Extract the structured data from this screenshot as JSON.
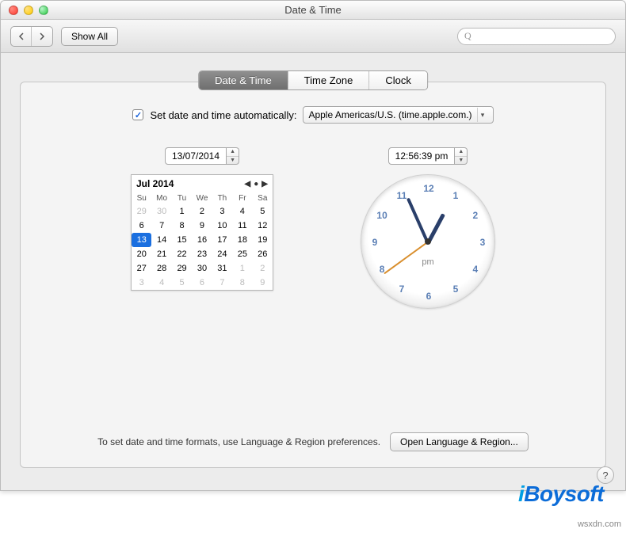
{
  "window": {
    "title": "Date & Time"
  },
  "toolbar": {
    "show_all": "Show All",
    "search_placeholder": ""
  },
  "search_icon_glyph": "Q",
  "tabs": {
    "date_time": "Date & Time",
    "time_zone": "Time Zone",
    "clock": "Clock"
  },
  "auto": {
    "checked": true,
    "label": "Set date and time automatically:",
    "server": "Apple Americas/U.S. (time.apple.com.)"
  },
  "date_field": "13/07/2014",
  "time_field": "12:56:39 pm",
  "calendar": {
    "month_label": "Jul 2014",
    "dow": [
      "Su",
      "Mo",
      "Tu",
      "We",
      "Th",
      "Fr",
      "Sa"
    ],
    "cells": [
      {
        "d": "29",
        "other": true
      },
      {
        "d": "30",
        "other": true
      },
      {
        "d": "1"
      },
      {
        "d": "2"
      },
      {
        "d": "3"
      },
      {
        "d": "4"
      },
      {
        "d": "5"
      },
      {
        "d": "6"
      },
      {
        "d": "7"
      },
      {
        "d": "8"
      },
      {
        "d": "9"
      },
      {
        "d": "10"
      },
      {
        "d": "11"
      },
      {
        "d": "12"
      },
      {
        "d": "13",
        "sel": true
      },
      {
        "d": "14"
      },
      {
        "d": "15"
      },
      {
        "d": "16"
      },
      {
        "d": "17"
      },
      {
        "d": "18"
      },
      {
        "d": "19"
      },
      {
        "d": "20"
      },
      {
        "d": "21"
      },
      {
        "d": "22"
      },
      {
        "d": "23"
      },
      {
        "d": "24"
      },
      {
        "d": "25"
      },
      {
        "d": "26"
      },
      {
        "d": "27"
      },
      {
        "d": "28"
      },
      {
        "d": "29"
      },
      {
        "d": "30"
      },
      {
        "d": "31"
      },
      {
        "d": "1",
        "other": true
      },
      {
        "d": "2",
        "other": true
      },
      {
        "d": "3",
        "other": true
      },
      {
        "d": "4",
        "other": true
      },
      {
        "d": "5",
        "other": true
      },
      {
        "d": "6",
        "other": true
      },
      {
        "d": "7",
        "other": true
      },
      {
        "d": "8",
        "other": true
      },
      {
        "d": "9",
        "other": true
      }
    ]
  },
  "clock": {
    "numbers": [
      "12",
      "1",
      "2",
      "3",
      "4",
      "5",
      "6",
      "7",
      "8",
      "9",
      "10",
      "11"
    ],
    "ampm": "pm",
    "hour_angle": 28,
    "minute_angle": 336,
    "second_angle": 234
  },
  "footer": {
    "hint": "To set date and time formats, use Language & Region preferences.",
    "button": "Open Language & Region..."
  },
  "help_glyph": "?",
  "watermark": {
    "pre": "i",
    "rest": "Boysoft",
    "site": "wsxdn.com"
  }
}
